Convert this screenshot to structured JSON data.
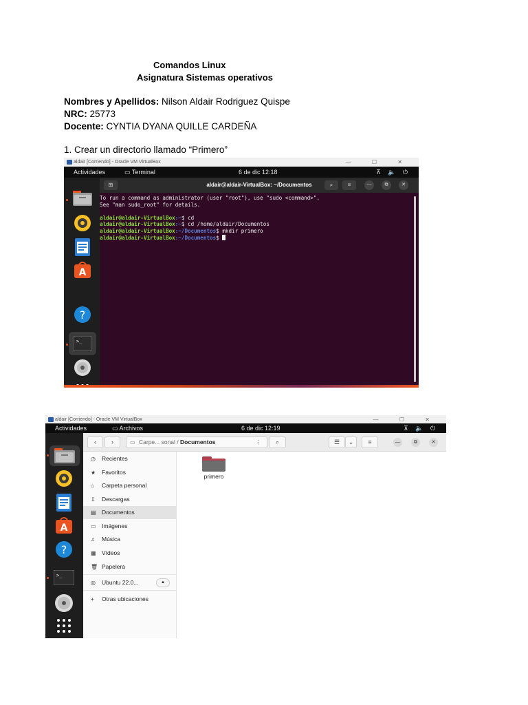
{
  "document": {
    "title": "Comandos Linux",
    "subtitle": "Asignatura Sistemas operativos",
    "fields": [
      {
        "label": "Nombres y Apellidos:",
        "value": " Nilson Aldair Rodriguez Quispe"
      },
      {
        "label": "NRC:",
        "value": " 25773"
      },
      {
        "label": "Docente:",
        "value": " CYNTIA DYANA QUILLE CARDEÑA"
      }
    ],
    "step1": "1. Crear un directorio llamado “Primero”"
  },
  "shot1": {
    "window_title": "aldair [Corriendo] - Oracle VM VirtualBox",
    "window_controls": "— ☐ ✕",
    "activities": "Actividades",
    "app_name": "▭ Terminal",
    "clock": "6 de dic  12:18",
    "tray": "⊼ 🔈 ⏻",
    "terminal_title": "aldair@aldair-VirtualBox: ~/Documentos",
    "new_tab": "⊞",
    "search": "⌕",
    "menu": "≡",
    "min": "—",
    "max": "⧉",
    "close": "✕",
    "lines": {
      "l1": "To run a command as administrator (user \"root\"), use \"sudo <command>\".",
      "l2": "See \"man sudo_root\" for details.",
      "p1": "aldair@aldair-VirtualBox",
      "d1": ":~",
      "c1": "$ cd",
      "p2": "aldair@aldair-VirtualBox",
      "d2": ":~",
      "c2": "$ cd /home/aldair/Documentos",
      "p3": "aldair@aldair-VirtualBox",
      "d3": ":~/Documentos",
      "c3": "$ mkdir primero",
      "p4": "aldair@aldair-VirtualBox",
      "d4": ":~/Documentos",
      "c4": "$ "
    },
    "dock_icons": [
      "files-icon",
      "rhythmbox-icon",
      "writer-icon",
      "software-icon",
      "help-icon",
      "terminal-icon",
      "disc-icon",
      "app-grid-icon"
    ]
  },
  "shot2": {
    "window_title": "aldair [Corriendo] - Oracle VM VirtualBox",
    "window_controls": "— ☐ ✕",
    "activities": "Actividades",
    "app_name": "▭ Archivos",
    "clock": "6 de dic  12:19",
    "tray": "⊼ 🔈 ⏻",
    "path_prefix": "Carpe... sonal",
    "path_sep": " / ",
    "path_current": "Documentos",
    "sidebar": [
      {
        "icon": "◷",
        "label": "Recientes",
        "name": "recent"
      },
      {
        "icon": "★",
        "label": "Favoritos",
        "name": "starred"
      },
      {
        "icon": "⌂",
        "label": "Carpeta personal",
        "name": "home"
      },
      {
        "icon": "⇩",
        "label": "Descargas",
        "name": "downloads"
      },
      {
        "icon": "▤",
        "label": "Documentos",
        "name": "documents"
      },
      {
        "icon": "▭",
        "label": "Imágenes",
        "name": "pictures"
      },
      {
        "icon": "♫",
        "label": "Música",
        "name": "music"
      },
      {
        "icon": "▦",
        "label": "Vídeos",
        "name": "videos"
      },
      {
        "icon": "🗑",
        "label": "Papelera",
        "name": "trash"
      },
      {
        "icon": "◎",
        "label": "Ubuntu 22.0...",
        "name": "ubuntu-drive"
      },
      {
        "icon": "+",
        "label": "Otras ubicaciones",
        "name": "other-locations"
      }
    ],
    "folder_label": "primero"
  },
  "colors": {
    "terminal_bg": "#300a24",
    "ubuntu_orange": "#e95420",
    "prompt_user": "#8ae234",
    "prompt_dir": "#5c7fd6"
  }
}
